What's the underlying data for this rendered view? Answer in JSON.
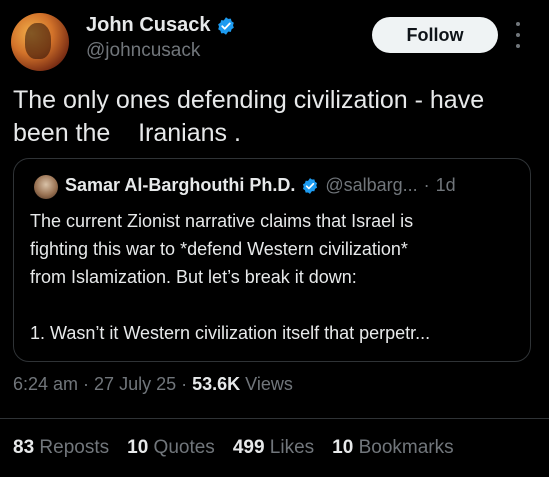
{
  "author": {
    "name": "John Cusack",
    "handle": "@johncusack",
    "verified": true
  },
  "follow_label": "Follow",
  "tweet": {
    "lines": [
      "The only ones defending civilization - have",
      "been the    Iranians ."
    ]
  },
  "quote": {
    "name": "Samar Al-Barghouthi Ph.D.",
    "handle": "@salbarg...",
    "separator": "·",
    "time": "1d",
    "lines": [
      "The current Zionist narrative claims that Israel is",
      "fighting this war to *defend Western civilization*",
      "from Islamization. But let’s break it down:",
      "1. Wasn’t it Western civilization itself that perpetr..."
    ]
  },
  "meta": {
    "time": "6:24 am",
    "date": "27 July 25",
    "separator": " · ",
    "views_count": "53.6K",
    "views_label": "Views"
  },
  "stats": {
    "reposts_count": "83",
    "reposts_label": "Reposts",
    "quotes_count": "10",
    "quotes_label": "Quotes",
    "likes_count": "499",
    "likes_label": "Likes",
    "bookmarks_count": "10",
    "bookmarks_label": "Bookmarks"
  },
  "colors": {
    "background": "#000000",
    "text": "#e7e9ea",
    "muted": "#71767b",
    "verified_badge": "#1d9bf0",
    "border": "#2f3336"
  },
  "icons": [
    "verified-badge-icon",
    "more-options-icon"
  ]
}
